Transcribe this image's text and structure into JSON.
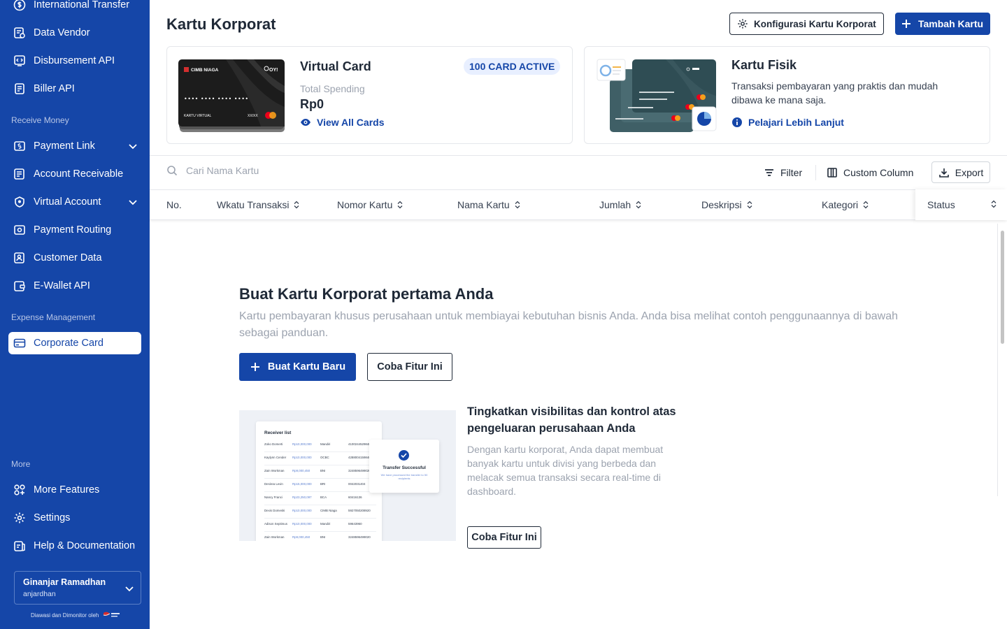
{
  "sidebar": {
    "items_top": [
      {
        "label": "International Transfer",
        "icon": "transfer-icon"
      },
      {
        "label": "Data Vendor",
        "icon": "vendor-icon"
      },
      {
        "label": "Disbursement API",
        "icon": "api-icon"
      },
      {
        "label": "Biller API",
        "icon": "biller-icon"
      }
    ],
    "receive_label": "Receive Money",
    "receive_items": [
      {
        "label": "Payment Link",
        "icon": "link-icon"
      },
      {
        "label": "Account Receivable",
        "icon": "receivable-icon"
      },
      {
        "label": "Virtual Account",
        "icon": "virtual-account-icon"
      },
      {
        "label": "Payment Routing",
        "icon": "routing-icon"
      },
      {
        "label": "Customer Data",
        "icon": "customer-icon"
      },
      {
        "label": "E-Wallet API",
        "icon": "wallet-icon"
      }
    ],
    "expense_label": "Expense Management",
    "expense_items": [
      {
        "label": "Corporate Card",
        "icon": "card-icon"
      }
    ],
    "more_label": "More",
    "more_items": [
      {
        "label": "More Features",
        "icon": "grid-icon"
      },
      {
        "label": "Settings",
        "icon": "gear-icon"
      },
      {
        "label": "Help & Documentation",
        "icon": "help-icon"
      }
    ],
    "user": {
      "name": "Ginanjar Ramadhan",
      "handle": "anjardhan"
    },
    "monitor_text": "Diawasi dan Dimonitor oleh"
  },
  "header": {
    "title": "Kartu Korporat",
    "config_button": "Konfigurasi Kartu Korporat",
    "add_button": "Tambah Kartu"
  },
  "virtual_card": {
    "title": "Virtual Card",
    "badge": "100 CARD ACTIVE",
    "total_label": "Total Spending",
    "total_value": "Rp0",
    "link": "View All Cards",
    "card_bank": "CIMB NIAGA",
    "card_brand": "OY!",
    "card_number": "•••• •••• •••• ••••",
    "card_label": "KARTU VIRTUAL",
    "card_expiry": "XX/XX"
  },
  "physical_card": {
    "title": "Kartu Fisik",
    "description": "Transaksi pembayaran yang praktis dan mudah dibawa ke mana saja.",
    "link": "Pelajari Lebih Lanjut"
  },
  "toolbar": {
    "search_placeholder": "Cari Nama Kartu",
    "filter": "Filter",
    "custom_column": "Custom Column",
    "export": "Export"
  },
  "table": {
    "columns": [
      "No.",
      "Wkatu Transaksi",
      "Nomor Kartu",
      "Nama Kartu",
      "Jumlah",
      "Deskripsi",
      "Kategori",
      "Status"
    ]
  },
  "empty_state": {
    "title": "Buat Kartu Korporat pertama Anda",
    "description": "Kartu pembayaran khusus perusahaan untuk membiayai kebutuhan bisnis Anda. Anda bisa melihat contoh penggunaannya di bawah sebagai panduan.",
    "primary_button": "Buat Kartu Baru",
    "secondary_button": "Coba Fitur Ini",
    "feature_title": "Tingkatkan visibilitas dan kontrol atas pengeluaran perusahaan Anda",
    "feature_desc": "Dengan kartu korporat, Anda dapat membuat banyak kartu untuk divisi yang berbeda dan melacak semua transaksi secara real-time di dashboard.",
    "feature_button": "Coba Fitur Ini"
  },
  "preview": {
    "list_title": "Receiver list",
    "rows": [
      [
        "Zoko Domerti",
        "Rp10,000,000",
        "Mandiri",
        "4100244529840"
      ],
      [
        "Kaylynn Cender",
        "Rp10,000,000",
        "OCBC",
        "4288004159840"
      ],
      [
        "Zain Workman",
        "Rp9,000,450",
        "BNI",
        "3248596499020"
      ],
      [
        "Desirea Levin",
        "Rp15,000,000",
        "BRI",
        "0042031404"
      ],
      [
        "Nancy Franci",
        "Rp23,250,097",
        "BCA",
        "60416136"
      ],
      [
        "Dexis Domeski",
        "Rp10,000,000",
        "CIMB Niaga",
        "5927050208920"
      ],
      [
        "Adison Septimus",
        "Rp10,000,000",
        "Mandiri",
        "59643960"
      ],
      [
        "Zain Workman",
        "Rp9,000,450",
        "BNI",
        "3248596499020"
      ]
    ],
    "success_title": "Transfer Successful",
    "success_sub": "We have processed the transfer to 50 recipients"
  },
  "colors": {
    "primary": "#1546a8",
    "sidebar_bg": "#1546a8",
    "text": "#1f2937",
    "muted": "#9ca3af"
  }
}
